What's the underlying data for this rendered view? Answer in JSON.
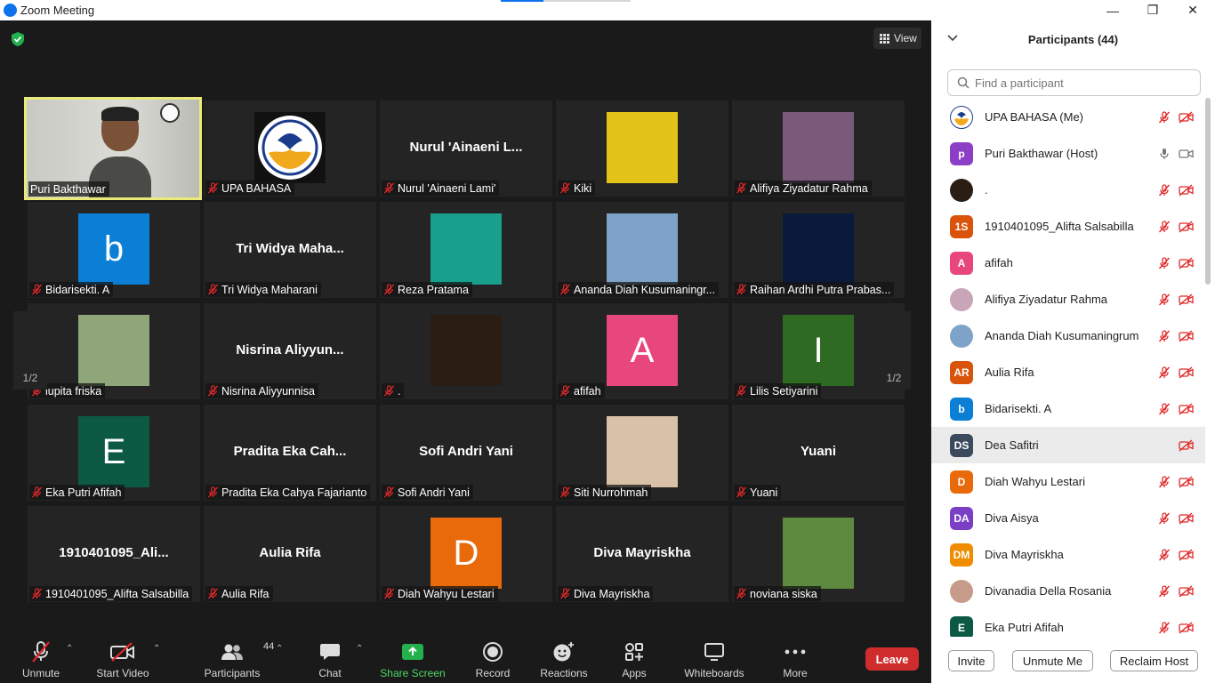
{
  "window": {
    "title": "Zoom Meeting",
    "minimize": "—",
    "restore": "❐",
    "close": "✕"
  },
  "meeting": {
    "view_label": "View",
    "page_left": "1/2",
    "page_right": "1/2",
    "tiles": [
      {
        "name": "Puri Bakthawar",
        "label": "Puri Bakthawar",
        "kind": "video",
        "muted": false,
        "active": true
      },
      {
        "name": "UPA BAHASA",
        "label": "UPA BAHASA",
        "kind": "logo",
        "muted": true
      },
      {
        "name": "Nurul  'Ainaeni L...",
        "label": "Nurul 'Ainaeni Lami'",
        "kind": "text",
        "muted": true
      },
      {
        "name": "Kiki",
        "label": "Kiki",
        "kind": "photo",
        "color": "#e3c21a",
        "muted": true
      },
      {
        "name": "Alifiya Ziyadatur Rahma",
        "label": "Alifiya Ziyadatur Rahma",
        "kind": "photo",
        "color": "#7a5a7a",
        "muted": true
      },
      {
        "name": "Bidarisekti. A",
        "label": "Bidarisekti. A",
        "kind": "letter",
        "letter": "b",
        "color": "#0b7fd6",
        "muted": true
      },
      {
        "name": "Tri  Widya  Maha...",
        "label": "Tri Widya Maharani",
        "kind": "text",
        "muted": true
      },
      {
        "name": "Reza Pratama",
        "label": "Reza Pratama",
        "kind": "photo",
        "color": "#18a08d",
        "muted": true
      },
      {
        "name": "Ananda Diah Kusumaningrum",
        "label": "Ananda Diah Kusumaningr...",
        "kind": "photo",
        "color": "#7fa3c8",
        "muted": true
      },
      {
        "name": "Raihan Ardhi Putra Prabaswara",
        "label": "Raihan Ardhi Putra Prabas...",
        "kind": "photo",
        "color": "#0a1a3a",
        "muted": true
      },
      {
        "name": "lupita friska",
        "label": "lupita friska",
        "kind": "photo",
        "color": "#8fa57a",
        "muted": true
      },
      {
        "name": "Nisrina  Aliyyun...",
        "label": "Nisrina Aliyyunnisa",
        "kind": "text",
        "muted": true
      },
      {
        "name": ".",
        "label": ".",
        "kind": "photo",
        "color": "#2a1d14",
        "muted": true
      },
      {
        "name": "afifah",
        "label": "afifah",
        "kind": "letter",
        "letter": "A",
        "color": "#e8477e",
        "muted": true
      },
      {
        "name": "Lilis Setiyarini",
        "label": "Lilis Setiyarini",
        "kind": "letter",
        "letter": "I",
        "color": "#2e6a22",
        "muted": true
      },
      {
        "name": "Eka Putri Afifah",
        "label": "Eka Putri Afifah",
        "kind": "letter",
        "letter": "E",
        "color": "#0d5a44",
        "muted": true
      },
      {
        "name": "Pradita  Eka  Cah...",
        "label": "Pradita Eka Cahya Fajarianto",
        "kind": "text",
        "muted": true
      },
      {
        "name": "Sofi Andri Yani",
        "label": "Sofi Andri Yani",
        "kind": "text",
        "muted": true
      },
      {
        "name": "Siti Nurrohmah",
        "label": "Siti Nurrohmah",
        "kind": "photo",
        "color": "#d9c1a8",
        "muted": true
      },
      {
        "name": "Yuani",
        "label": "Yuani",
        "kind": "text",
        "muted": true
      },
      {
        "name": "1910401095_Ali...",
        "label": "1910401095_Alifta Salsabilla",
        "kind": "text",
        "muted": true
      },
      {
        "name": "Aulia Rifa",
        "label": "Aulia Rifa",
        "kind": "text",
        "muted": true
      },
      {
        "name": "Diah Wahyu Lestari",
        "label": "Diah Wahyu Lestari",
        "kind": "letter",
        "letter": "D",
        "color": "#e86a0a",
        "muted": true
      },
      {
        "name": "Diva Mayriskha",
        "label": "Diva Mayriskha",
        "kind": "text",
        "muted": true
      },
      {
        "name": "noviana siska",
        "label": "noviana siska",
        "kind": "photo",
        "color": "#5d8a3e",
        "muted": true
      }
    ]
  },
  "toolbar": {
    "unmute": "Unmute",
    "start_video": "Start Video",
    "participants": "Participants",
    "participants_count": "44",
    "chat": "Chat",
    "share_screen": "Share Screen",
    "record": "Record",
    "reactions": "Reactions",
    "apps": "Apps",
    "whiteboards": "Whiteboards",
    "more": "More",
    "leave": "Leave",
    "colors": {
      "share": "#4cd964",
      "leave": "#cf2d2d"
    }
  },
  "panel": {
    "title": "Participants (44)",
    "search_placeholder": "Find a participant",
    "participants": [
      {
        "name": "UPA BAHASA (Me)",
        "initials": "",
        "color": "#2a6fb0",
        "muted": true,
        "video_off": true
      },
      {
        "name": "Puri Bakthawar (Host)",
        "initials": "p",
        "color": "#8c3fc6",
        "muted": false,
        "video_off": false
      },
      {
        "name": ".",
        "initials": "",
        "color": "#2a1d14",
        "muted": true,
        "video_off": true
      },
      {
        "name": "1910401095_Alifta Salsabilla",
        "initials": "1S",
        "color": "#d9530a",
        "muted": true,
        "video_off": true
      },
      {
        "name": "afifah",
        "initials": "A",
        "color": "#e8477e",
        "muted": true,
        "video_off": true
      },
      {
        "name": "Alifiya Ziyadatur Rahma",
        "initials": "",
        "color": "#c9a5b8",
        "muted": true,
        "video_off": true
      },
      {
        "name": "Ananda Diah Kusumaningrum",
        "initials": "",
        "color": "#7fa3c8",
        "muted": true,
        "video_off": true
      },
      {
        "name": "Aulia Rifa",
        "initials": "AR",
        "color": "#d9530a",
        "muted": true,
        "video_off": true
      },
      {
        "name": "Bidarisekti. A",
        "initials": "b",
        "color": "#0b7fd6",
        "muted": true,
        "video_off": true
      },
      {
        "name": "Dea Safitri",
        "initials": "DS",
        "color": "#3b4a5c",
        "muted": false,
        "video_off": true,
        "highlight": true
      },
      {
        "name": "Diah Wahyu Lestari",
        "initials": "D",
        "color": "#e86a0a",
        "muted": true,
        "video_off": true
      },
      {
        "name": "Diva Aisya",
        "initials": "DA",
        "color": "#7b3fc6",
        "muted": true,
        "video_off": true
      },
      {
        "name": "Diva Mayriskha",
        "initials": "DM",
        "color": "#f08c00",
        "muted": true,
        "video_off": true
      },
      {
        "name": "Divanadia Della Rosania",
        "initials": "",
        "color": "#c79b8a",
        "muted": true,
        "video_off": true
      },
      {
        "name": "Eka Putri Afifah",
        "initials": "E",
        "color": "#0d5a44",
        "muted": true,
        "video_off": true
      }
    ],
    "invite": "Invite",
    "unmute_me": "Unmute Me",
    "reclaim_host": "Reclaim Host"
  }
}
